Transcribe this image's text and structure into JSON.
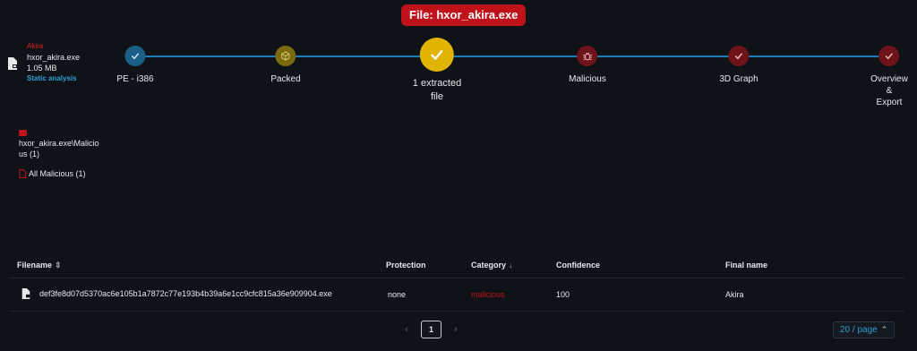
{
  "header": {
    "file_title": "File: hxor_akira.exe"
  },
  "file_info": {
    "family": "Akira",
    "name": "hxor_akira.exe",
    "size": "1.05 MB",
    "link": "Static analysis"
  },
  "steps": [
    {
      "label": "PE - i386",
      "icon": "check-icon",
      "color": "#1b5f86"
    },
    {
      "label": "Packed",
      "icon": "box-icon",
      "color": "#7a6a12"
    },
    {
      "label": "1 extracted\nfile",
      "icon": "check-icon",
      "color": "#e0b400"
    },
    {
      "label": "Malicious",
      "icon": "bug-icon",
      "color": "#6e1318"
    },
    {
      "label": "3D Graph",
      "icon": "check-icon",
      "color": "#6e1318"
    },
    {
      "label": "Overview &\nExport",
      "icon": "check-icon",
      "color": "#6e1318"
    }
  ],
  "tree": {
    "path": "hxor_akira.exe\\Malicio\nus (1)",
    "all": "All Malicious (1)"
  },
  "table": {
    "headers": {
      "filename": "Filename",
      "protection": "Protection",
      "category": "Category",
      "confidence": "Confidence",
      "final_name": "Final name"
    },
    "rows": [
      {
        "filename": "def3fe8d07d5370ac6e105b1a7872c77e193b4b39a6e1cc9cfc815a36e909904.exe",
        "protection": "none",
        "category": "malicious",
        "confidence": "100",
        "final_name": "Akira"
      }
    ]
  },
  "pagination": {
    "current": "1",
    "per_page": "20 / page"
  },
  "colors": {
    "accent": "#2d9fd6",
    "danger": "#c0121a",
    "background": "#0f1318"
  }
}
